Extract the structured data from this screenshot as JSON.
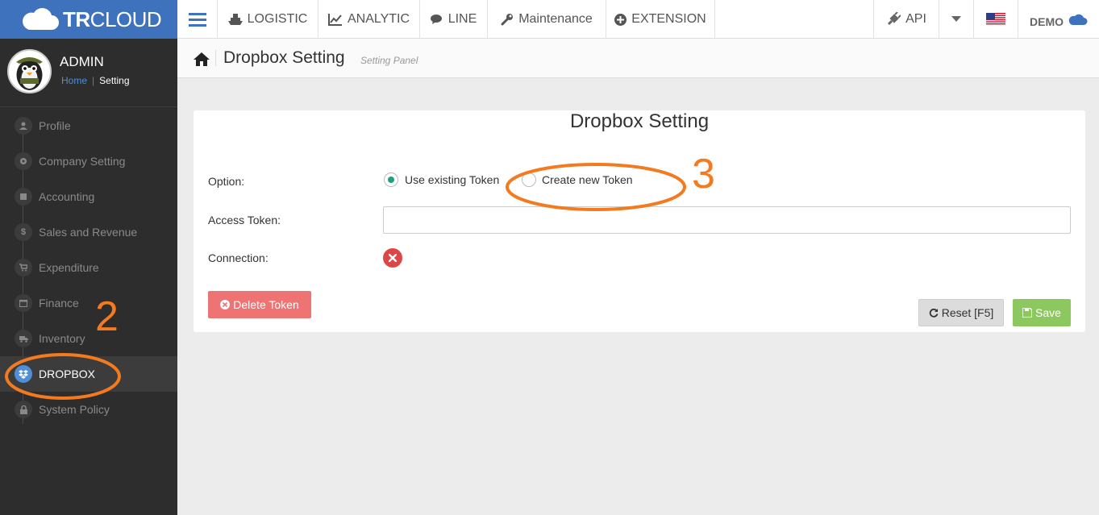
{
  "topbar": {
    "brand_bold": "TR",
    "brand_light": "CLOUD",
    "nav": [
      {
        "label": "LOGISTIC",
        "icon": "ship-icon"
      },
      {
        "label": "ANALYTIC",
        "icon": "line-chart-icon"
      },
      {
        "label": "LINE",
        "icon": "comments-icon"
      },
      {
        "label": "Maintenance",
        "icon": "wrench-icon"
      },
      {
        "label": "EXTENSION",
        "icon": "plus-circle-icon"
      }
    ],
    "api_label": "API",
    "user_label": "DEMO",
    "colors": {
      "brand": "#3f72bd"
    }
  },
  "sidebar": {
    "user_name": "ADMIN",
    "breadcrumb": {
      "home": "Home",
      "current": "Setting"
    },
    "items": [
      {
        "label": "Profile",
        "icon": "user-icon"
      },
      {
        "label": "Company Setting",
        "icon": "gear-icon"
      },
      {
        "label": "Accounting",
        "icon": "book-icon"
      },
      {
        "label": "Sales and Revenue",
        "icon": "dollar-icon"
      },
      {
        "label": "Expenditure",
        "icon": "cart-icon"
      },
      {
        "label": "Finance",
        "icon": "calendar-icon"
      },
      {
        "label": "Inventory",
        "icon": "truck-icon"
      },
      {
        "label": "DROPBOX",
        "icon": "dropbox-icon",
        "active": true
      },
      {
        "label": "System Policy",
        "icon": "lock-icon"
      }
    ]
  },
  "page": {
    "title": "Dropbox Setting",
    "subtitle": "Setting Panel"
  },
  "panel": {
    "title": "Dropbox Setting",
    "option_label": "Option:",
    "option_existing": "Use existing Token",
    "option_new": "Create new Token",
    "selected_option": "existing",
    "access_token_label": "Access Token:",
    "access_token_value": "",
    "connection_label": "Connection:",
    "connection_status": "disconnected",
    "delete_button": "Delete Token",
    "reset_button": "Reset [F5]",
    "save_button": "Save"
  },
  "annotations": {
    "step2": "2",
    "step3": "3",
    "color": "#f47a1f"
  }
}
